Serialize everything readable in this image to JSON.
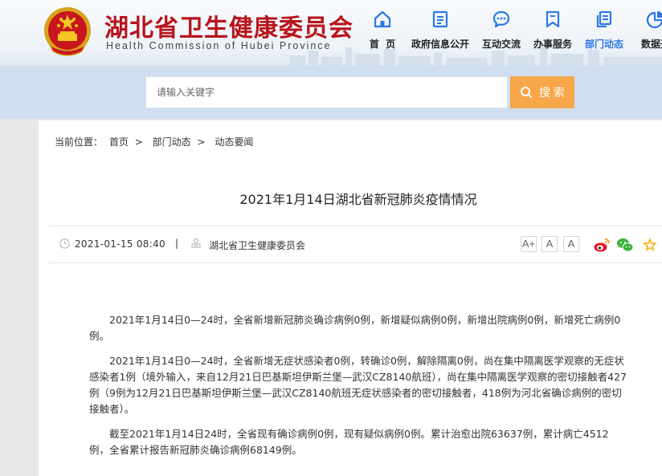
{
  "header": {
    "title_cn": "湖北省卫生健康委员会",
    "title_en": "Health Commission of Hubei Province"
  },
  "nav": [
    {
      "label": "首  页",
      "icon": "home-icon"
    },
    {
      "label": "政府信息公开",
      "icon": "document-icon"
    },
    {
      "label": "互动交流",
      "icon": "chat-bubble-icon"
    },
    {
      "label": "办事服务",
      "icon": "bookmark-icon"
    },
    {
      "label": "部门动态",
      "icon": "copy-document-icon",
      "active": true
    },
    {
      "label": "数据开",
      "icon": "pie-chart-icon"
    }
  ],
  "search": {
    "placeholder": "请输入关键字",
    "button_label": "搜 索"
  },
  "breadcrumb": {
    "prefix": "当前位置：",
    "items": [
      "首页",
      "部门动态",
      "动态要闻"
    ],
    "separator": ">"
  },
  "article": {
    "title": "2021年1月14日湖北省新冠肺炎疫情情况",
    "date": "2021-01-15 08:40",
    "divider": "|",
    "source": "湖北省卫生健康委员会",
    "font_controls": [
      "A+",
      "A",
      "A"
    ],
    "paragraphs": [
      "2021年1月14日0—24时，全省新增新冠肺炎确诊病例0例，新增疑似病例0例，新增出院病例0例，新增死亡病例0例。",
      "2021年1月14日0—24时，全省新增无症状感染者0例，转确诊0例，解除隔离0例，尚在集中隔离医学观察的无症状感染者1例（境外输入，来自12月21日巴基斯坦伊斯兰堡—武汉CZ8140航班），尚在集中隔离医学观察的密切接触者427例（9例为12月21日巴基斯坦伊斯兰堡—武汉CZ8140航班无症状感染者的密切接触者，418例为河北省确诊病例的密切接触者）。",
      "截至2021年1月14日24时，全省现有确诊病例0例，现有疑似病例0例。累计治愈出院63637例，累计病亡4512例，全省累计报告新冠肺炎确诊病例68149例。"
    ]
  },
  "colors": {
    "title_red": "#b8141b",
    "nav_blue": "#2b78e4",
    "search_orange": "#f7a64a",
    "band_blue": "#cfdff0"
  }
}
